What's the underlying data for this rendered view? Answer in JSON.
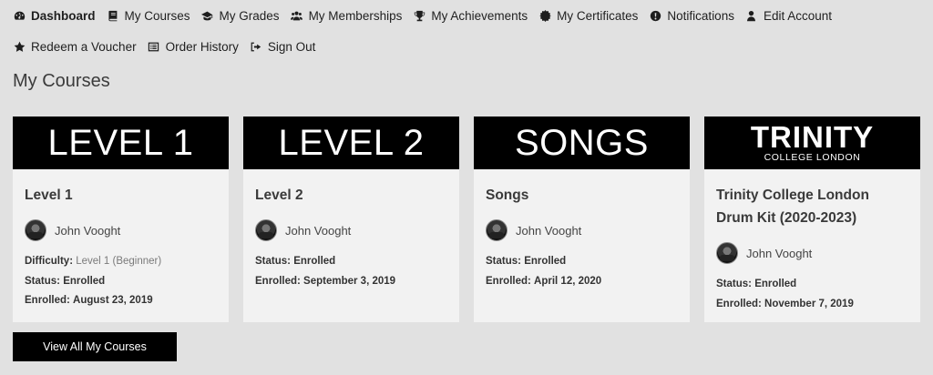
{
  "nav": {
    "row1": [
      {
        "label": "Dashboard",
        "icon": "tachometer-icon",
        "active": true
      },
      {
        "label": "My Courses",
        "icon": "book-icon"
      },
      {
        "label": "My Grades",
        "icon": "graduation-cap-icon"
      },
      {
        "label": "My Memberships",
        "icon": "users-icon"
      },
      {
        "label": "My Achievements",
        "icon": "trophy-icon"
      },
      {
        "label": "My Certificates",
        "icon": "certificate-icon"
      },
      {
        "label": "Notifications",
        "icon": "exclamation-circle-icon"
      },
      {
        "label": "Edit Account",
        "icon": "user-icon"
      }
    ],
    "row2": [
      {
        "label": "Redeem a Voucher",
        "icon": "star-icon"
      },
      {
        "label": "Order History",
        "icon": "list-alt-icon"
      },
      {
        "label": "Sign Out",
        "icon": "sign-out-icon"
      }
    ]
  },
  "page_title": "My Courses",
  "courses": [
    {
      "banner": "LEVEL 1",
      "title": "Level 1",
      "author": "John Vooght",
      "difficulty_label": "Difficulty:",
      "difficulty": "Level 1 (Beginner)",
      "status_label": "Status:",
      "status": "Enrolled",
      "enrolled_label": "Enrolled:",
      "enrolled": "August 23, 2019"
    },
    {
      "banner": "LEVEL 2",
      "title": "Level 2",
      "author": "John Vooght",
      "status_label": "Status:",
      "status": "Enrolled",
      "enrolled_label": "Enrolled:",
      "enrolled": "September 3, 2019"
    },
    {
      "banner": "SONGS",
      "title": "Songs",
      "author": "John Vooght",
      "status_label": "Status:",
      "status": "Enrolled",
      "enrolled_label": "Enrolled:",
      "enrolled": "April 12, 2020"
    },
    {
      "banner_main": "TRINITY",
      "banner_sub": "COLLEGE LONDON",
      "title": "Trinity College London Drum Kit (2020-2023)",
      "author": "John Vooght",
      "status_label": "Status:",
      "status": "Enrolled",
      "enrolled_label": "Enrolled:",
      "enrolled": "November 7, 2019"
    }
  ],
  "view_all_label": "View All My Courses"
}
